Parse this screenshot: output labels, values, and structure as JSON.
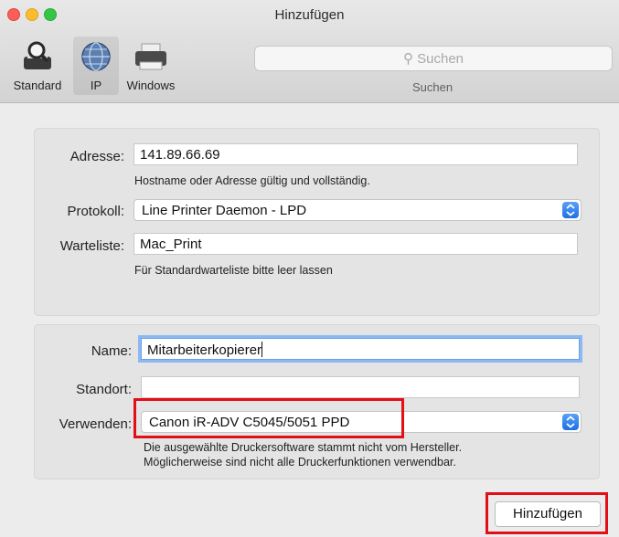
{
  "window": {
    "title": "Hinzufügen"
  },
  "toolbar": {
    "items": [
      {
        "label": "Standard",
        "icon": "magnifier-printer-icon"
      },
      {
        "label": "IP",
        "icon": "globe-icon",
        "selected": true
      },
      {
        "label": "Windows",
        "icon": "printer-icon"
      }
    ],
    "search": {
      "placeholder": "Suchen",
      "caption": "Suchen"
    }
  },
  "connection": {
    "address_label": "Adresse:",
    "address_value": "141.89.66.69",
    "address_hint": "Hostname oder Adresse gültig und vollständig.",
    "protocol_label": "Protokoll:",
    "protocol_value": "Line Printer Daemon - LPD",
    "queue_label": "Warteliste:",
    "queue_value": "Mac_Print",
    "queue_hint": "Für Standardwarteliste bitte leer lassen"
  },
  "printer": {
    "name_label": "Name:",
    "name_value": "Mitarbeiterkopierer",
    "location_label": "Standort:",
    "location_value": "",
    "use_label": "Verwenden:",
    "use_value": "Canon iR-ADV C5045/5051 PPD",
    "use_hint_line1": "Die ausgewählte Druckersoftware stammt nicht vom Hersteller.",
    "use_hint_line2": "Möglicherweise sind nicht alle Druckerfunktionen verwendbar."
  },
  "actions": {
    "add_label": "Hinzufügen"
  },
  "colors": {
    "highlight": "#e20f16",
    "accent": "#1c6fe5"
  }
}
